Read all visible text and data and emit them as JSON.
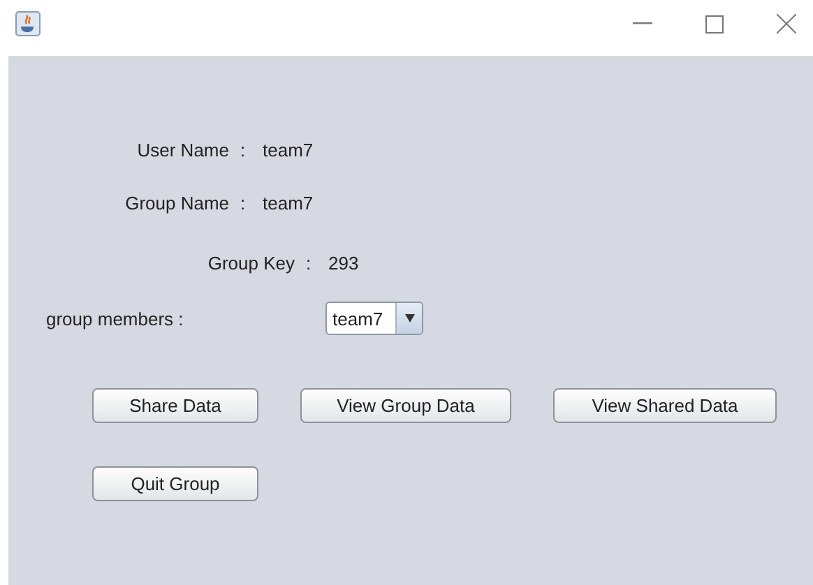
{
  "info": [
    {
      "label": "User Name",
      "separator": ":",
      "value": "team7"
    },
    {
      "label": "Group Name",
      "separator": ":",
      "value": "team7"
    },
    {
      "label": "Group Key",
      "separator": ":",
      "value": "293"
    }
  ],
  "members": {
    "label": "group members :",
    "value": "team7"
  },
  "buttons": [
    "Share Data",
    "View Group Data",
    "View Shared Data"
  ],
  "quit_button": "Quit Group"
}
